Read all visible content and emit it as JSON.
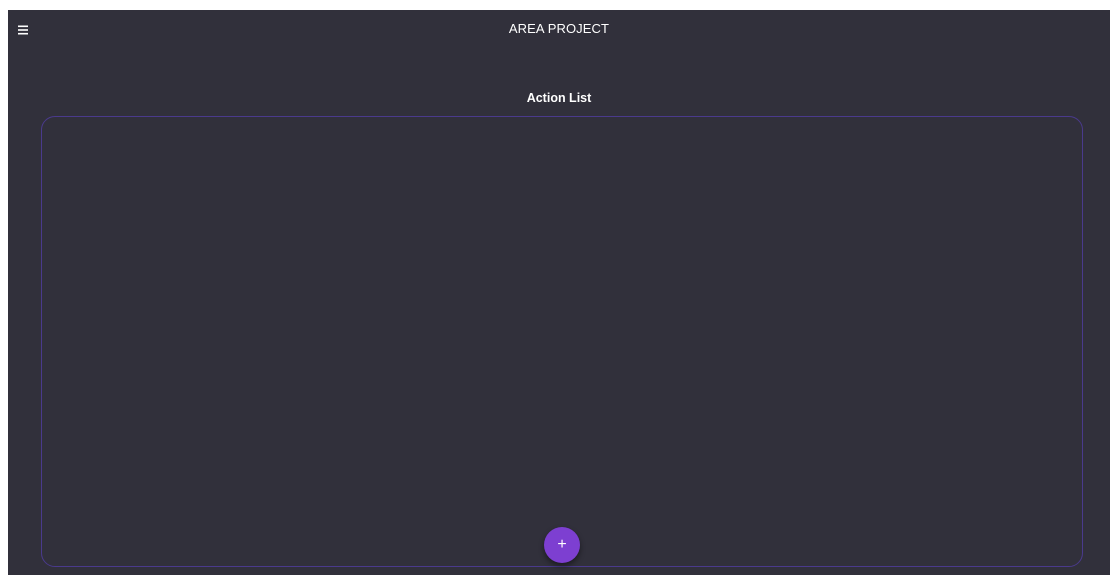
{
  "appbar": {
    "title": "AREA PROJECT",
    "menu_icon": "hamburger-menu-icon"
  },
  "main": {
    "section_title": "Action List",
    "items": []
  },
  "fab": {
    "label": "+",
    "icon": "plus-icon"
  },
  "colors": {
    "background": "#31303b",
    "panel_border": "#4a3a8c",
    "accent": "#7d3fd1",
    "text": "#ffffff"
  }
}
